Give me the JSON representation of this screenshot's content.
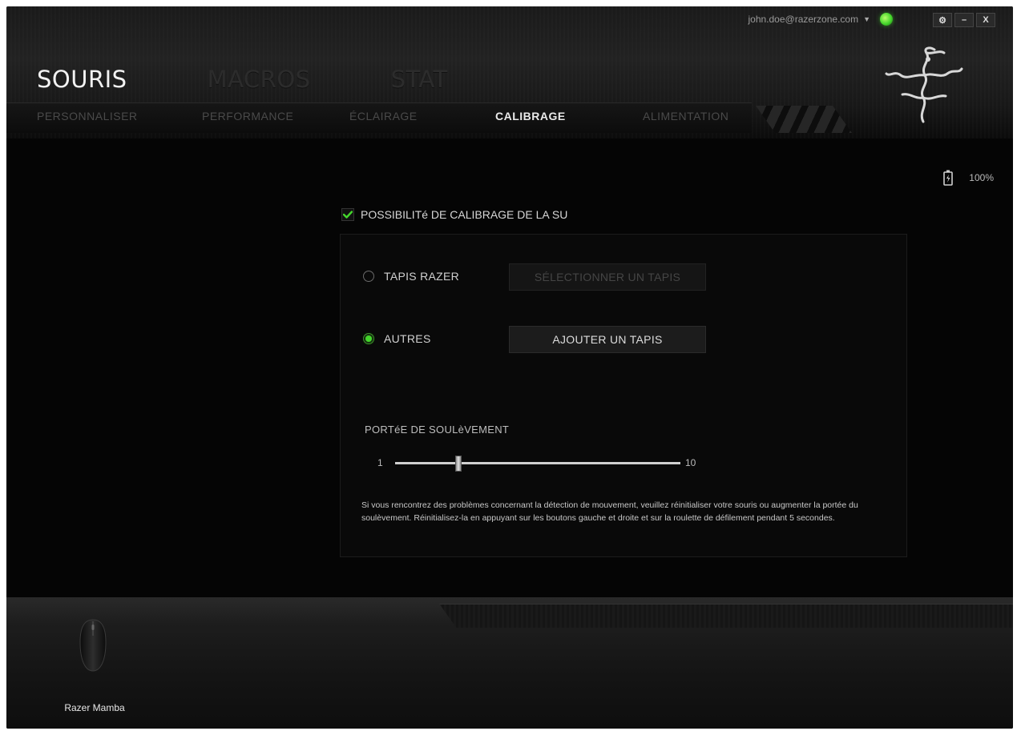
{
  "window": {
    "account_email": "john.doe@razerzone.com",
    "controls": {
      "settings": "⚙",
      "minimize": "–",
      "close": "X"
    }
  },
  "main_nav": [
    {
      "label": "SOURIS",
      "active": true
    },
    {
      "label": "MACROS",
      "active": false
    },
    {
      "label": "STAT",
      "active": false
    }
  ],
  "sub_nav": [
    {
      "label": "PERSONNALISER",
      "active": false
    },
    {
      "label": "PERFORMANCE",
      "active": false
    },
    {
      "label": "ÉCLAIRAGE",
      "active": false
    },
    {
      "label": "CALIBRAGE",
      "active": true
    },
    {
      "label": "ALIMENTATION",
      "active": false
    }
  ],
  "battery": {
    "level": "100%",
    "value": 1.0
  },
  "calibration": {
    "enable_label": "POSSIBILITé DE CALIBRAGE DE LA SU",
    "enabled": true,
    "option_razer": {
      "label": "TAPIS RAZER",
      "selected": false,
      "button": "SÉLECTIONNER UN TAPIS"
    },
    "option_other": {
      "label": "AUTRES",
      "selected": true,
      "button": "AJOUTER UN TAPIS"
    },
    "lift_range": {
      "title": "PORTéE DE SOULèVEMENT",
      "min": 1,
      "max": 10,
      "value": 3,
      "min_label": "1",
      "max_label": "10"
    },
    "help_text": "Si vous rencontrez des problèmes concernant la détection de mouvement, veuillez réinitialiser votre souris ou augmenter la portée du soulèvement. Réinitialisez-la en appuyant sur les boutons gauche et droite et sur la roulette de défilement pendant 5 secondes."
  },
  "device": {
    "name": "Razer Mamba"
  },
  "colors": {
    "accent": "#44d62c",
    "background": "#050505"
  }
}
